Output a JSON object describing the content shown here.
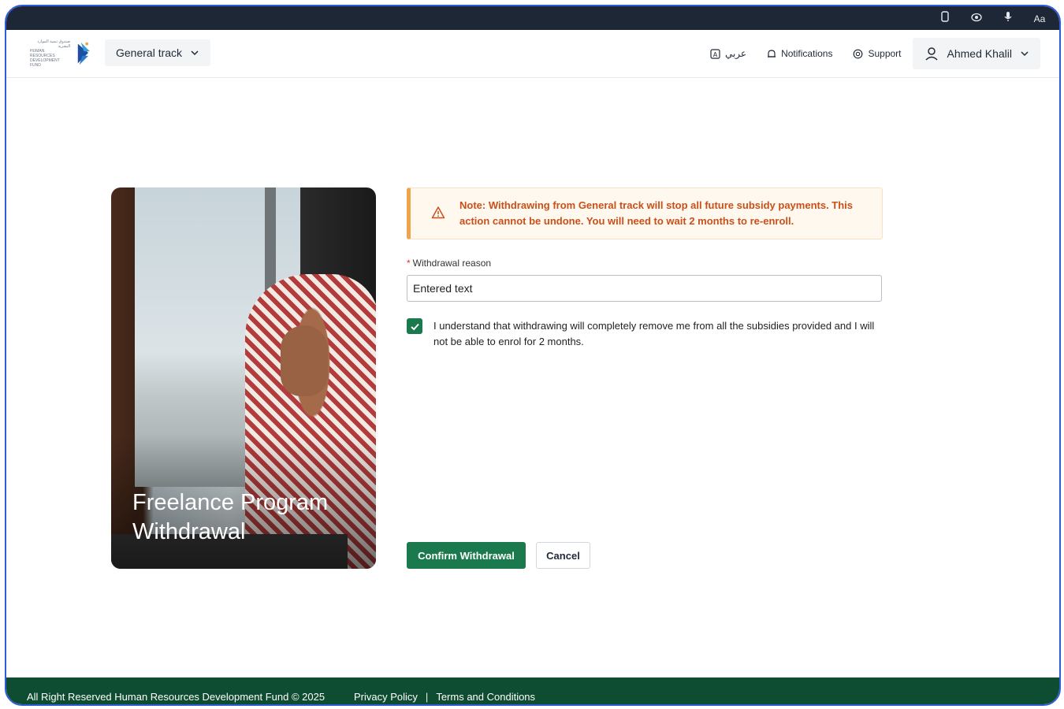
{
  "system_bar": {
    "icons": [
      "phone-icon",
      "eye-icon",
      "microphone-icon",
      "text-size-icon"
    ],
    "text_size_label": "Aa"
  },
  "header": {
    "logo_alt": "Human Resources Development Fund",
    "logo_text_ar": "صندوق تنمية الموارد البشرية",
    "logo_text_en": "HUMAN RESOURCES DEVELOPMENT FUND",
    "track_select": "General track",
    "language": "عربي",
    "notifications": "Notifications",
    "support": "Support",
    "user_name": "Ahmed Khalil"
  },
  "hero": {
    "title": "Freelance Program Withdrawal"
  },
  "notice": {
    "message": "Note: Withdrawing from General track will stop all future subsidy payments. This action cannot be undone. You will need to wait 2 months to re-enroll.",
    "color": "#c8501b"
  },
  "form": {
    "reason_label": "Withdrawal reason",
    "required_mark": "*",
    "reason_value": "Entered text",
    "acknowledgement": "I understand that withdrawing will completely remove me from all the subsidies provided and I will not be able to enrol for 2 months.",
    "acknowledged": true,
    "confirm_label": "Confirm Withdrawal",
    "cancel_label": "Cancel"
  },
  "footer": {
    "copyright": "All Right Reserved Human Resources Development Fund © 2025",
    "privacy": "Privacy Policy",
    "separator": "|",
    "terms": "Terms and Conditions"
  },
  "colors": {
    "primary_green": "#1a7a4d",
    "footer_green": "#0e4d31",
    "warning_orange": "#f0a44a"
  }
}
